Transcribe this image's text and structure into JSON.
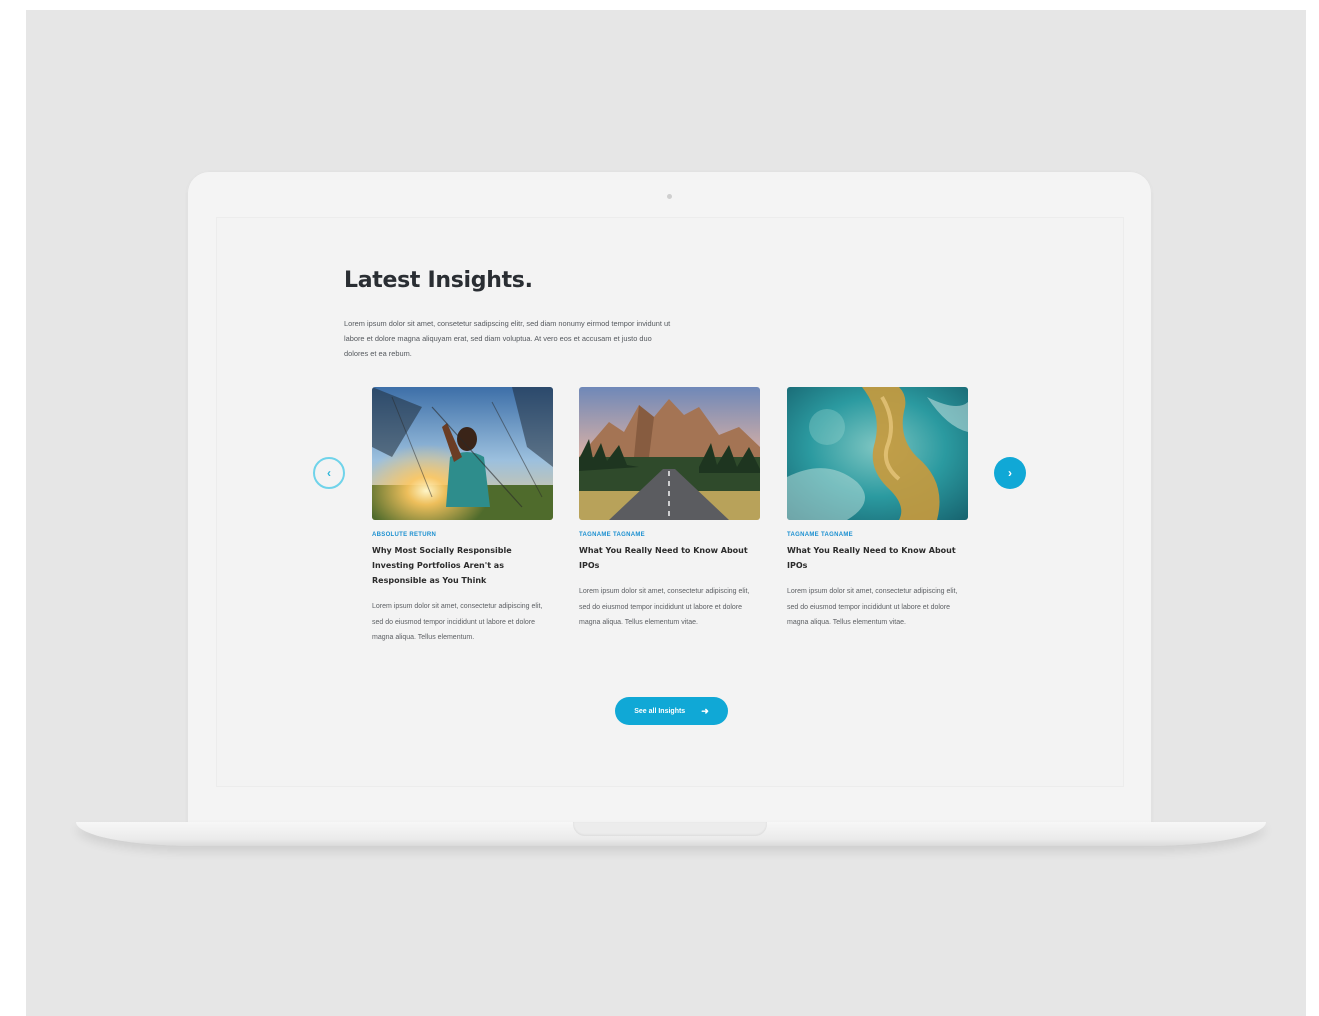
{
  "section": {
    "title": "Latest Insights.",
    "intro": "Lorem ipsum dolor sit amet, consetetur sadipscing elitr, sed diam nonumy eirmod tempor invidunt ut labore et dolore magna aliquyam erat, sed diam voluptua. At vero eos et accusam et justo duo dolores et ea rebum."
  },
  "carousel": {
    "prev_icon": "chevron-left-icon",
    "next_icon": "chevron-right-icon",
    "prev_glyph": "‹",
    "next_glyph": "›"
  },
  "cards": [
    {
      "category": "Absolute Return",
      "headline": "Why Most Socially Responsible Investing Portfolios Aren't as Responsible as You Think",
      "excerpt": "Lorem ipsum dolor sit amet, consectetur adipiscing elit, sed do eiusmod tempor incididunt ut labore et dolore magna aliqua. Tellus elementum.",
      "image": "person-taking-selfie-at-sunset"
    },
    {
      "category": "Tagname Tagname",
      "headline": "What You Really Need to Know About IPOs",
      "excerpt": "Lorem ipsum dolor sit amet, consectetur adipiscing elit, sed do eiusmod tempor incididunt ut labore et dolore magna aliqua. Tellus elementum vitae.",
      "image": "mountain-road-landscape"
    },
    {
      "category": "Tagname Tagname",
      "headline": "What You Really Need to Know About IPOs",
      "excerpt": "Lorem ipsum dolor sit amet, consectetur adipiscing elit, sed do eiusmod tempor incididunt ut labore et dolore magna aliqua. Tellus elementum vitae.",
      "image": "aerial-turquoise-coastline"
    }
  ],
  "cta": {
    "label": "See all Insights",
    "icon": "arrow-right-icon",
    "glyph": "➜"
  },
  "colors": {
    "accent": "#10a8d6",
    "category": "#1a8fd0",
    "heading": "#2a2e33"
  }
}
